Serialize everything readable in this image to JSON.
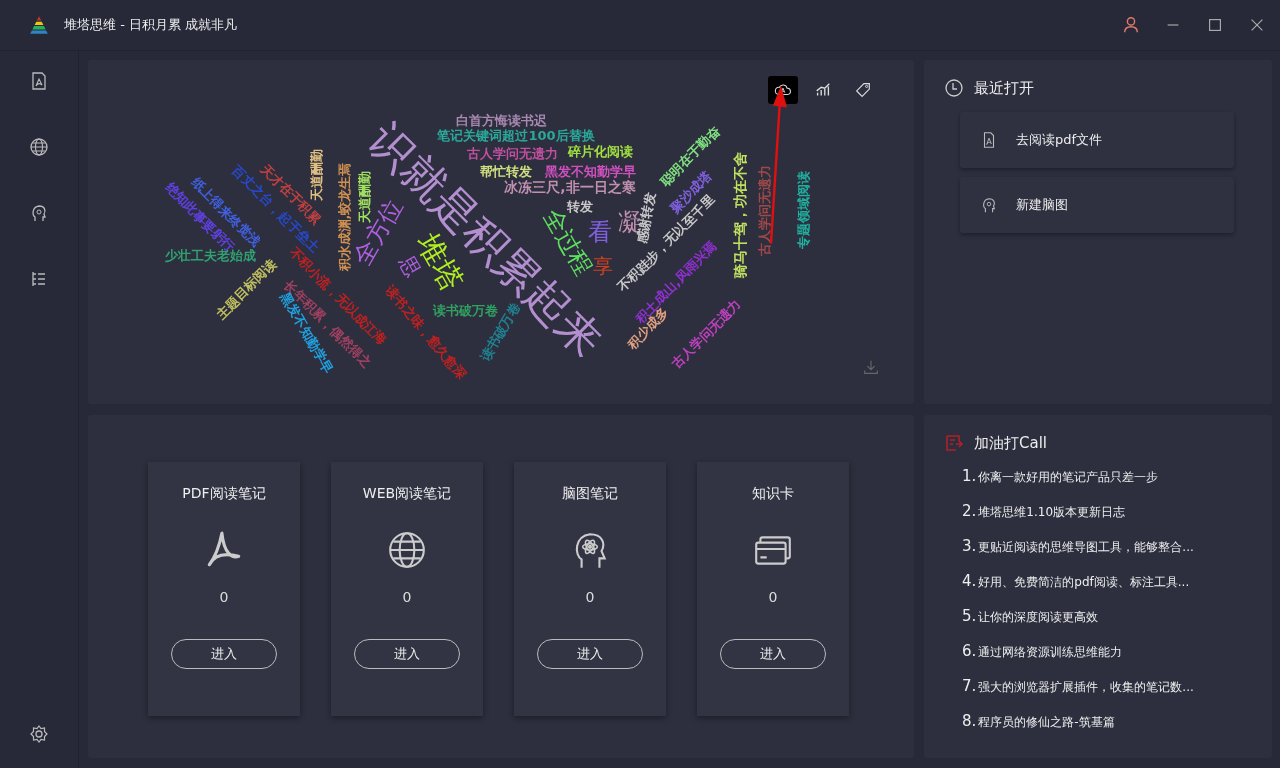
{
  "window": {
    "title": "堆塔思维 - 日积月累 成就非凡"
  },
  "word_cloud": {
    "view_buttons": [
      {
        "selected": true
      },
      {
        "selected": false
      },
      {
        "selected": false
      }
    ],
    "words": [
      {
        "text": "识就是积累起来",
        "color": "#b48fd0"
      },
      {
        "text": "白首方悔读书迟",
        "color": "#a888b0"
      },
      {
        "text": "笔记关键词超过100后替换",
        "color": "#2aa89a"
      },
      {
        "text": "古人学问无遗力",
        "color": "#c050a0"
      },
      {
        "text": "碎片化阅读",
        "color": "#a0e040"
      },
      {
        "text": "帮忙转发",
        "color": "#d0e080"
      },
      {
        "text": "黑发不知勤学早",
        "color": "#d050c0"
      },
      {
        "text": "冰冻三尺,非一日之寒",
        "color": "#c090b0"
      },
      {
        "text": "转发",
        "color": "#c8c8c8"
      },
      {
        "text": "全过程",
        "color": "#60e060"
      },
      {
        "text": "看",
        "color": "#8060e0"
      },
      {
        "text": "凝",
        "color": "#c090b0"
      },
      {
        "text": "堆塔",
        "color": "#b0f020"
      },
      {
        "text": "全方位",
        "color": "#b060e0"
      },
      {
        "text": "思",
        "color": "#b060e0"
      },
      {
        "text": "享",
        "color": "#d04020"
      },
      {
        "text": "读书破万卷",
        "color": "#30a060"
      },
      {
        "text": "不积跬步，无以至千里",
        "color": "#c8c8c8"
      },
      {
        "text": "感谢转发",
        "color": "#c8c8c8"
      },
      {
        "text": "聚沙成塔",
        "color": "#8060e0"
      },
      {
        "text": "聪明在于勤奋",
        "color": "#80e080"
      },
      {
        "text": "积土成山,风雨兴焉",
        "color": "#9030d0"
      },
      {
        "text": "积少成多",
        "color": "#e0a080"
      },
      {
        "text": "古人学问无遗力",
        "color": "#c040c0"
      },
      {
        "text": "骑马十驾，功在不舍",
        "color": "#c0e060"
      },
      {
        "text": "古人学问无遗力",
        "color": "#a04848"
      },
      {
        "text": "专题领域阅读",
        "color": "#20b0a0"
      },
      {
        "text": "天道酬勤",
        "color": "#e0c080"
      },
      {
        "text": "天道酬勤",
        "color": "#a0e060"
      },
      {
        "text": "积水成渊,蛟龙生焉",
        "color": "#d09050"
      },
      {
        "text": "天才在于积累",
        "color": "#c04040"
      },
      {
        "text": "百丈之台，起于垒土",
        "color": "#2848c8"
      },
      {
        "text": "纸上得来终觉浅",
        "color": "#4060e0"
      },
      {
        "text": "绝知此事要躬行",
        "color": "#6040e0"
      },
      {
        "text": "少壮工夫老始成",
        "color": "#30a070"
      },
      {
        "text": "不积小流，无以成江海",
        "color": "#c02020"
      },
      {
        "text": "主题目标阅读",
        "color": "#c0c060"
      },
      {
        "text": "长年积累，偶然得之",
        "color": "#a04060"
      },
      {
        "text": "黑发不知勤学早",
        "color": "#20a0e0"
      },
      {
        "text": "读书之味，愈久愈深",
        "color": "#c02020"
      },
      {
        "text": "读书破万卷",
        "color": "#208090"
      }
    ]
  },
  "recent": {
    "title": "最近打开",
    "items": [
      {
        "kind": "pdf",
        "label": "去阅读pdf文件"
      },
      {
        "kind": "mindmap",
        "label": "新建脑图"
      }
    ]
  },
  "notes": [
    {
      "kind": "pdf",
      "title": "PDF阅读笔记",
      "count": "0",
      "button": "进入"
    },
    {
      "kind": "web",
      "title": "WEB阅读笔记",
      "count": "0",
      "button": "进入"
    },
    {
      "kind": "mindmap",
      "title": "脑图笔记",
      "count": "0",
      "button": "进入"
    },
    {
      "kind": "card",
      "title": "知识卡",
      "count": "0",
      "button": "进入"
    }
  ],
  "cheer": {
    "title": "加油打Call",
    "items": [
      {
        "number": "1.",
        "text": "你离一款好用的笔记产品只差一步"
      },
      {
        "number": "2.",
        "text": "堆塔思维1.10版本更新日志"
      },
      {
        "number": "3.",
        "text": "更贴近阅读的思维导图工具，能够整合..."
      },
      {
        "number": "4.",
        "text": "好用、免费简洁的pdf阅读、标注工具..."
      },
      {
        "number": "5.",
        "text": "让你的深度阅读更高效"
      },
      {
        "number": "6.",
        "text": "通过网络资源训练思维能力"
      },
      {
        "number": "7.",
        "text": "强大的浏览器扩展插件，收集的笔记数..."
      },
      {
        "number": "8.",
        "text": " 程序员的修仙之路-筑基篇"
      }
    ]
  }
}
